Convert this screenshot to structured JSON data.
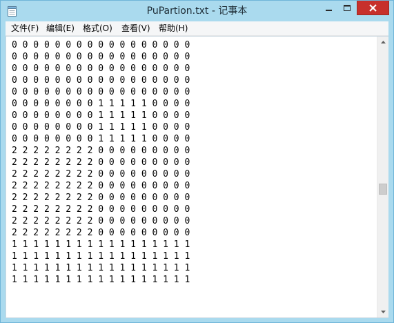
{
  "window": {
    "title": "PuPartion.txt - 记事本",
    "app_icon": "notepad-icon",
    "controls": {
      "minimize_icon": "minimize-icon",
      "maximize_icon": "maximize-icon",
      "close_icon": "close-icon",
      "close_color": "#c7302b"
    }
  },
  "menu": {
    "file": "文件(F)",
    "edit": "编辑(E)",
    "format": "格式(O)",
    "view": "查看(V)",
    "help": "帮助(H)"
  },
  "document": {
    "lines": [
      "0 0 0 0 0 0 0 0 0 0 0 0 0 0 0 0 0",
      "0 0 0 0 0 0 0 0 0 0 0 0 0 0 0 0 0",
      "0 0 0 0 0 0 0 0 0 0 0 0 0 0 0 0 0",
      "0 0 0 0 0 0 0 0 0 0 0 0 0 0 0 0 0",
      "0 0 0 0 0 0 0 0 0 0 0 0 0 0 0 0 0",
      "0 0 0 0 0 0 0 0 1 1 1 1 1 0 0 0 0",
      "0 0 0 0 0 0 0 0 1 1 1 1 1 0 0 0 0",
      "0 0 0 0 0 0 0 0 1 1 1 1 1 0 0 0 0",
      "0 0 0 0 0 0 0 0 1 1 1 1 1 0 0 0 0",
      "2 2 2 2 2 2 2 2 0 0 0 0 0 0 0 0 0",
      "2 2 2 2 2 2 2 2 0 0 0 0 0 0 0 0 0",
      "2 2 2 2 2 2 2 2 0 0 0 0 0 0 0 0 0",
      "2 2 2 2 2 2 2 2 0 0 0 0 0 0 0 0 0",
      "2 2 2 2 2 2 2 2 0 0 0 0 0 0 0 0 0",
      "2 2 2 2 2 2 2 2 0 0 0 0 0 0 0 0 0",
      "2 2 2 2 2 2 2 2 0 0 0 0 0 0 0 0 0",
      "2 2 2 2 2 2 2 2 0 0 0 0 0 0 0 0 0",
      "1 1 1 1 1 1 1 1 1 1 1 1 1 1 1 1 1",
      "1 1 1 1 1 1 1 1 1 1 1 1 1 1 1 1 1",
      "1 1 1 1 1 1 1 1 1 1 1 1 1 1 1 1 1",
      "1 1 1 1 1 1 1 1 1 1 1 1 1 1 1 1 1"
    ]
  },
  "scrollbar": {
    "up_icon": "scroll-up-arrow-icon",
    "down_icon": "scroll-down-arrow-icon",
    "position_fraction": 0.55
  }
}
